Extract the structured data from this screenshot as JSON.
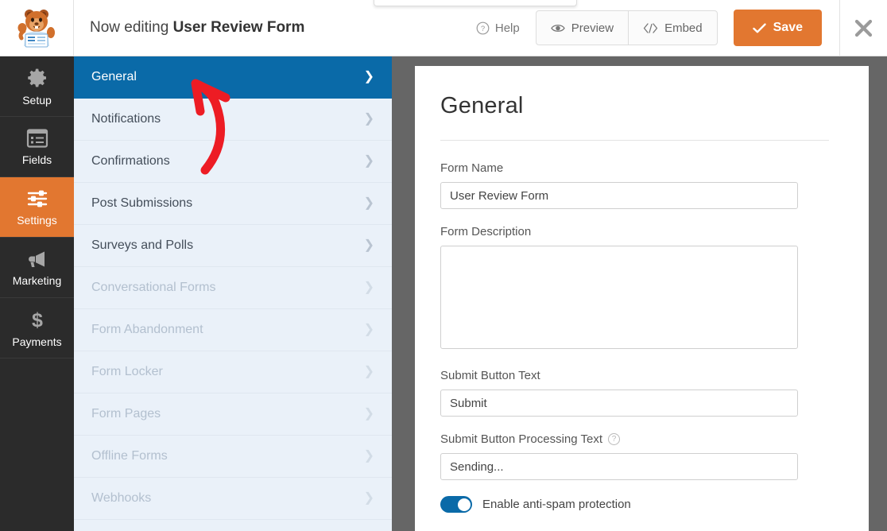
{
  "header": {
    "logo_icon": "wpforms-beaver-mascot-logo",
    "editing_prefix": "Now editing",
    "form_title": "User Review Form",
    "help_label": "Help",
    "help_icon": "question-circle-icon",
    "preview_label": "Preview",
    "preview_icon": "eye-icon",
    "embed_label": "Embed",
    "embed_icon": "code-brackets-icon",
    "save_label": "Save",
    "save_icon": "check-icon",
    "close_icon": "close-x-icon"
  },
  "rail": {
    "items": [
      {
        "label": "Setup",
        "icon": "gear-icon",
        "active": false
      },
      {
        "label": "Fields",
        "icon": "form-list-icon",
        "active": false
      },
      {
        "label": "Settings",
        "icon": "sliders-icon",
        "active": true
      },
      {
        "label": "Marketing",
        "icon": "megaphone-icon",
        "active": false
      },
      {
        "label": "Payments",
        "icon": "dollar-sign-icon",
        "active": false
      }
    ]
  },
  "menu": {
    "items": [
      {
        "label": "General",
        "active": true,
        "disabled": false
      },
      {
        "label": "Notifications",
        "active": false,
        "disabled": false
      },
      {
        "label": "Confirmations",
        "active": false,
        "disabled": false
      },
      {
        "label": "Post Submissions",
        "active": false,
        "disabled": false
      },
      {
        "label": "Surveys and Polls",
        "active": false,
        "disabled": false
      },
      {
        "label": "Conversational Forms",
        "active": false,
        "disabled": true
      },
      {
        "label": "Form Abandonment",
        "active": false,
        "disabled": true
      },
      {
        "label": "Form Locker",
        "active": false,
        "disabled": true
      },
      {
        "label": "Form Pages",
        "active": false,
        "disabled": true
      },
      {
        "label": "Offline Forms",
        "active": false,
        "disabled": true
      },
      {
        "label": "Webhooks",
        "active": false,
        "disabled": true
      }
    ],
    "chevron_icon": "chevron-right-icon"
  },
  "panel": {
    "title": "General",
    "form_name_label": "Form Name",
    "form_name_value": "User Review Form",
    "form_description_label": "Form Description",
    "form_description_value": "",
    "submit_button_text_label": "Submit Button Text",
    "submit_button_text_value": "Submit",
    "submit_processing_label": "Submit Button Processing Text",
    "submit_processing_help_icon": "question-circle-icon",
    "submit_processing_value": "Sending...",
    "antispam_label": "Enable anti-spam protection",
    "antispam_enabled": true
  },
  "annotation": {
    "arrow_icon": "red-curved-arrow-annotation",
    "color": "#ed1c24"
  },
  "colors": {
    "accent_orange": "#e27730",
    "accent_blue": "#0a6aa8",
    "menu_bg": "#eaf1f9",
    "rail_bg": "#2b2b2b",
    "backdrop_grey": "#666666"
  }
}
